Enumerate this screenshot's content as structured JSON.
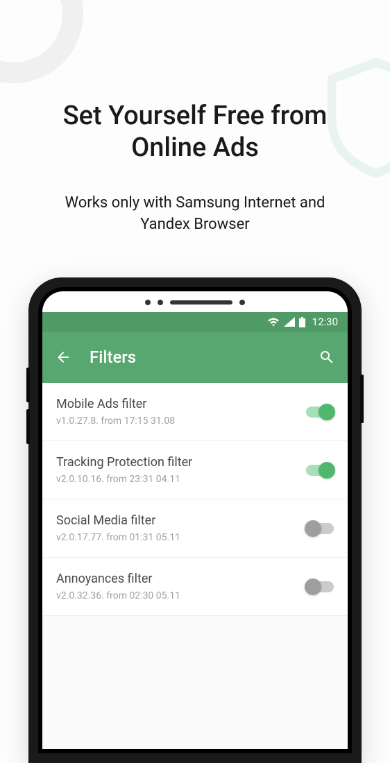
{
  "promo": {
    "headline": "Set Yourself Free from Online Ads",
    "subheadline": "Works only with Samsung Internet and Yandex Browser"
  },
  "status_bar": {
    "time": "12:30"
  },
  "app_bar": {
    "title": "Filters"
  },
  "colors": {
    "status_bar_bg": "#509a66",
    "app_bar_bg": "#59a770",
    "toggle_on": "#4fb86e"
  },
  "filters": [
    {
      "title": "Mobile Ads filter",
      "subtitle": "v1.0.27.8. from 17:15 31.08",
      "enabled": true
    },
    {
      "title": "Tracking Protection filter",
      "subtitle": "v2.0.10.16. from 23:31 04.11",
      "enabled": true
    },
    {
      "title": "Social Media filter",
      "subtitle": "v2.0.17.77. from 01:31 05.11",
      "enabled": false
    },
    {
      "title": "Annoyances filter",
      "subtitle": "v2.0.32.36. from 02:30 05.11",
      "enabled": false
    }
  ]
}
